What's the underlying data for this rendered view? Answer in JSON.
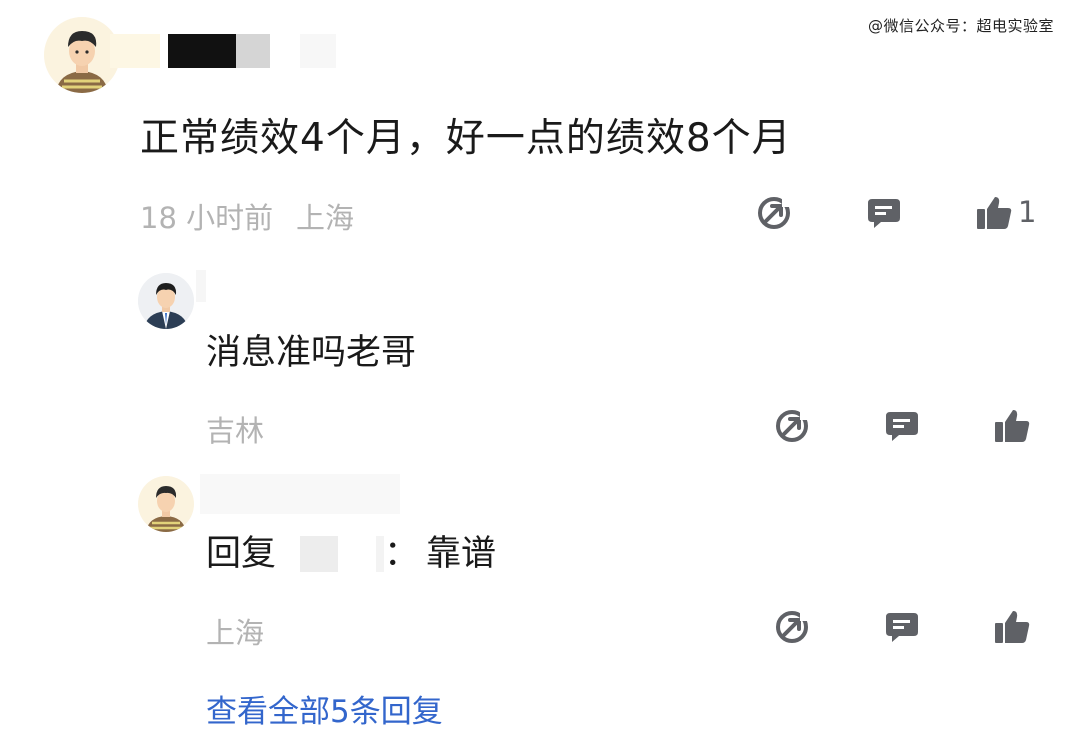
{
  "watermark": "@微信公众号：超电实验室",
  "comment": {
    "avatar_icon": "cartoon-man-avatar-icon",
    "text": "正常绩效4个月，好一点的绩效8个月",
    "time": "18 小时前",
    "location": "上海",
    "like_count": "1"
  },
  "replies": [
    {
      "avatar_icon": "cartoon-man-suit-avatar-icon",
      "text": "消息准吗老哥",
      "location": "吉林"
    },
    {
      "avatar_icon": "cartoon-man-avatar-icon",
      "reply_prefix": "回复",
      "reply_colon": "：",
      "text": "靠谱",
      "location": "上海"
    }
  ],
  "view_all_replies": "查看全部5条回复",
  "colors": {
    "meta_gray": "#b3b3b3",
    "icon_gray": "#5f6166",
    "link_blue": "#3366cc"
  }
}
